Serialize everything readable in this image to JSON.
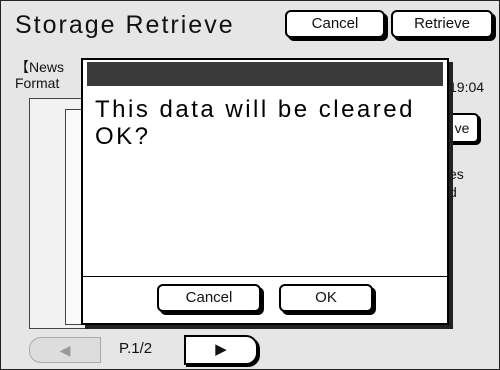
{
  "header": {
    "title": "Storage Retrieve",
    "cancel_label": "Cancel",
    "retrieve_label": "Retrieve"
  },
  "background": {
    "name_fragment": "【News",
    "format_fragment": "Format",
    "time_fragment": "19:04",
    "button_fragment": "ve",
    "es_fragment": "es",
    "d_fragment": "d"
  },
  "pager": {
    "prev_arrow": "◀",
    "page_label": "P.1/2",
    "next_arrow": "▶"
  },
  "dialog": {
    "message": "This data will be cleared\nOK?",
    "cancel_label": "Cancel",
    "ok_label": "OK"
  }
}
